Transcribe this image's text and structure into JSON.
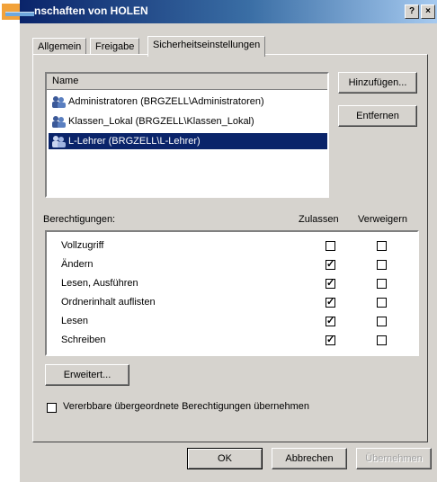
{
  "window": {
    "title": "nschaften von HOLEN",
    "help_btn": "?",
    "close_btn": "×"
  },
  "tabs": [
    {
      "label": "Allgemein"
    },
    {
      "label": "Freigabe"
    },
    {
      "label": "Sicherheitseinstellungen"
    }
  ],
  "users": {
    "header": "Name",
    "items": [
      {
        "label": "Administratoren (BRGZELL\\Administratoren)"
      },
      {
        "label": "Klassen_Lokal (BRGZELL\\Klassen_Lokal)"
      },
      {
        "label": "L-Lehrer (BRGZELL\\L-Lehrer)"
      }
    ],
    "add_button": "Hinzufügen...",
    "remove_button": "Entfernen"
  },
  "permissions": {
    "label": "Berechtigungen:",
    "allow_header": "Zulassen",
    "deny_header": "Verweigern",
    "rows": [
      {
        "label": "Vollzugriff",
        "allow": false,
        "deny": false
      },
      {
        "label": "Ändern",
        "allow": true,
        "deny": false
      },
      {
        "label": "Lesen, Ausführen",
        "allow": true,
        "deny": false
      },
      {
        "label": "Ordnerinhalt auflisten",
        "allow": true,
        "deny": false
      },
      {
        "label": "Lesen",
        "allow": true,
        "deny": false
      },
      {
        "label": "Schreiben",
        "allow": true,
        "deny": false
      }
    ],
    "check_glyph": "✓"
  },
  "advanced_button": "Erweitert...",
  "inherit_checkbox": {
    "label": "Vererbbare übergeordnete Berechtigungen übernehmen",
    "checked": false
  },
  "footer": {
    "ok": "OK",
    "cancel": "Abbrechen",
    "apply": "Übernehmen"
  },
  "colors": {
    "selection": "#0a246a",
    "face": "#d6d3ce"
  }
}
